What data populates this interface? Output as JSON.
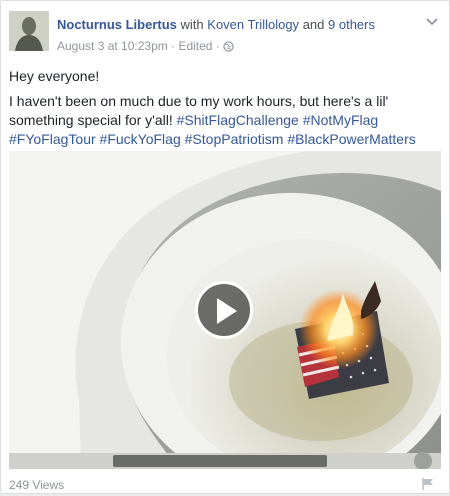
{
  "post": {
    "author": "Nocturnus Libertus",
    "with_text": "with",
    "tagged_person": "Koven Trillology",
    "and_text": "and",
    "others_link": "9 others",
    "timestamp": "August 3 at 10:23pm",
    "separator": "·",
    "edited": "Edited",
    "privacy_icon": "globe-icon",
    "menu_icon": "chevron-down-icon",
    "greeting": "Hey everyone!",
    "body_text": "I haven't been on much due to my work hours, but here's a lil' something special for y'all!",
    "hashtags": [
      "#ShitFlagChallenge",
      "#NotMyFlag",
      "#FYoFlagTour",
      "#FuckYoFlag",
      "#StopPatriotism",
      "#BlackPowerMatters"
    ],
    "video": {
      "play_icon": "play-icon",
      "views": "249 Views"
    },
    "report_icon": "flag-icon"
  },
  "colors": {
    "link": "#365899",
    "text": "#1d2129",
    "muted": "#90949c",
    "fire": "#ffb23a"
  }
}
